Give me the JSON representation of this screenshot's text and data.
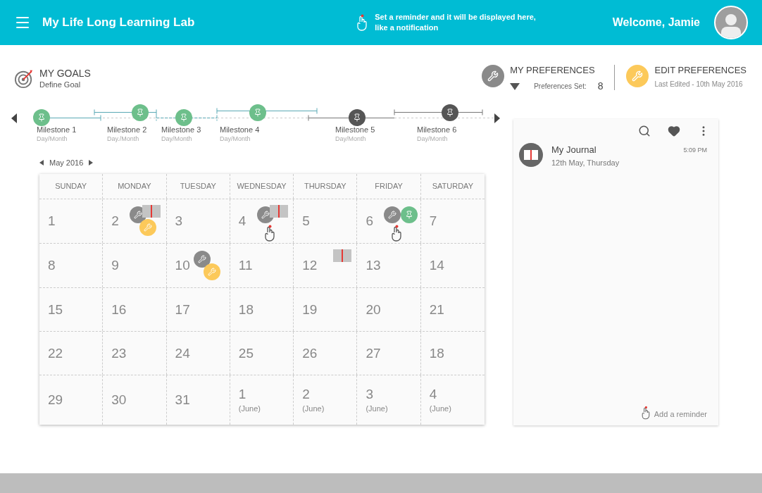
{
  "header": {
    "title": "My Life Long Learning Lab",
    "notification": "Set a reminder and it will be displayed here, like a notification",
    "welcome": "Welcome, Jamie"
  },
  "goals": {
    "title": "MY GOALS",
    "subtitle": "Define Goal"
  },
  "preferences": {
    "title": "MY PREFERENCES",
    "count_label": "Preferences Set:",
    "count": "8"
  },
  "edit_preferences": {
    "title": "EDIT PREFERENCES",
    "subtitle": "Last Edited - 10th May 2016"
  },
  "milestones": [
    {
      "name": "Milestone 1",
      "date": "Day/Month",
      "color": "#6dbf8b"
    },
    {
      "name": "Milestone 2",
      "date": "Day./Month",
      "color": "#6dbf8b"
    },
    {
      "name": "Milestone 3",
      "date": "Day/Month",
      "color": "#6dbf8b"
    },
    {
      "name": "Milestone 4",
      "date": "Day/Month",
      "color": "#6dbf8b"
    },
    {
      "name": "Milestone 5",
      "date": "Day/Month",
      "color": "#555555"
    },
    {
      "name": "Milestone 6",
      "date": "Day/Month",
      "color": "#555555"
    }
  ],
  "calendar": {
    "month": "May 2016",
    "weekdays": [
      "SUNDAY",
      "MONDAY",
      "TUESDAY",
      "WEDNESDAY",
      "THURSDAY",
      "FRIDAY",
      "SATURDAY"
    ],
    "days": [
      {
        "day": "1"
      },
      {
        "day": "2",
        "events": [
          {
            "kind": "preference"
          },
          {
            "kind": "edit"
          },
          {
            "kind": "journal"
          }
        ]
      },
      {
        "day": "3"
      },
      {
        "day": "4",
        "events": [
          {
            "kind": "preference"
          },
          {
            "kind": "journal"
          },
          {
            "kind": "reminder"
          }
        ]
      },
      {
        "day": "5"
      },
      {
        "day": "6",
        "events": [
          {
            "kind": "preference"
          },
          {
            "kind": "milestone"
          },
          {
            "kind": "reminder"
          }
        ]
      },
      {
        "day": "7"
      },
      {
        "day": "8"
      },
      {
        "day": "9"
      },
      {
        "day": "10",
        "events": [
          {
            "kind": "preference"
          },
          {
            "kind": "edit"
          }
        ]
      },
      {
        "day": "11"
      },
      {
        "day": "12",
        "events": [
          {
            "kind": "journal"
          }
        ]
      },
      {
        "day": "13"
      },
      {
        "day": "14"
      },
      {
        "day": "15"
      },
      {
        "day": "16"
      },
      {
        "day": "17"
      },
      {
        "day": "18"
      },
      {
        "day": "19"
      },
      {
        "day": "20"
      },
      {
        "day": "21"
      },
      {
        "day": "22"
      },
      {
        "day": "23"
      },
      {
        "day": "24"
      },
      {
        "day": "25"
      },
      {
        "day": "26"
      },
      {
        "day": "27"
      },
      {
        "day": "18"
      },
      {
        "day": "29"
      },
      {
        "day": "30"
      },
      {
        "day": "31"
      },
      {
        "day": "1",
        "note": "(June)"
      },
      {
        "day": "2",
        "note": "(June)"
      },
      {
        "day": "3",
        "note": "(June)"
      },
      {
        "day": "4",
        "note": "(June)"
      }
    ]
  },
  "journal": {
    "title": "My Journal",
    "date": "12th May, Thursday",
    "time": "5:09 PM"
  },
  "add_reminder": "Add a reminder"
}
